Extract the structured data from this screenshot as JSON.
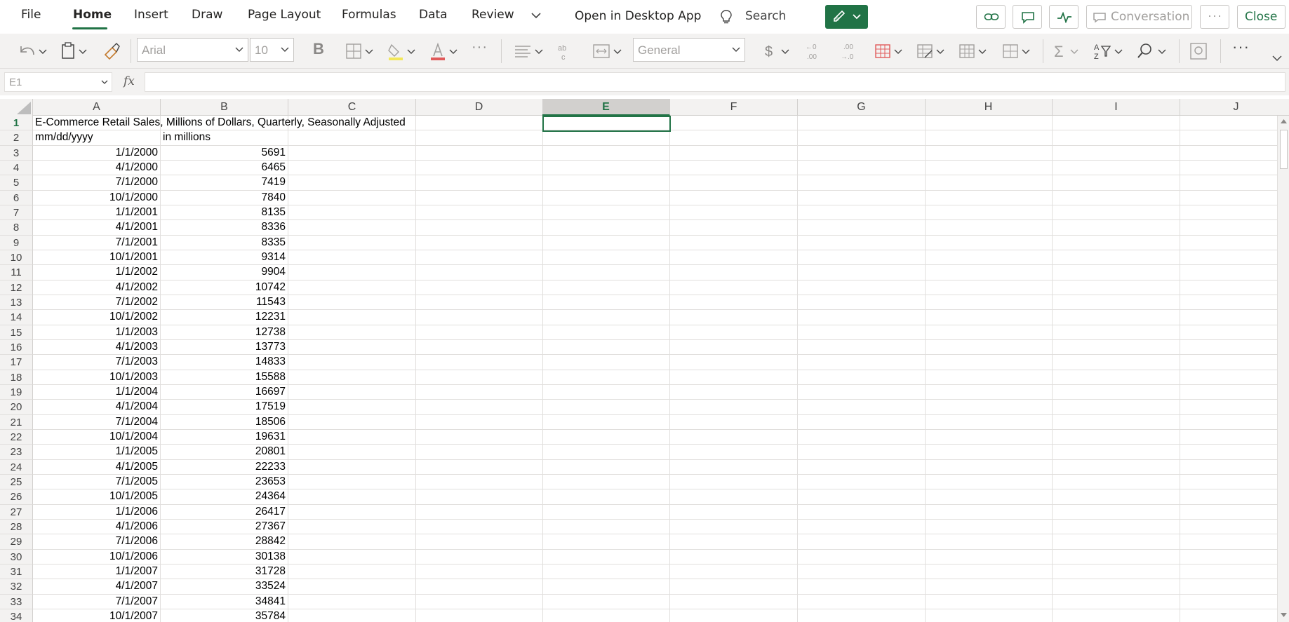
{
  "menu": {
    "items": [
      "File",
      "Home",
      "Insert",
      "Draw",
      "Page Layout",
      "Formulas",
      "Data",
      "Review"
    ],
    "open_desktop": "Open in Desktop App",
    "search": "Search",
    "conversation": "Conversation",
    "close": "Close"
  },
  "ribbon": {
    "font_name": "Arial",
    "font_size": "10",
    "number_format": "General"
  },
  "formula_bar": {
    "name_box": "E1",
    "fx": "fx",
    "formula": ""
  },
  "columns": [
    "A",
    "B",
    "C",
    "D",
    "E",
    "F",
    "G",
    "H",
    "I",
    "J"
  ],
  "selected_column": "E",
  "sheet": {
    "title": "E-Commerce Retail Sales, Millions of Dollars, Quarterly, Seasonally Adjusted",
    "header_a": "mm/dd/yyyy",
    "header_b": "in millions",
    "rows": [
      {
        "n": "3",
        "date": "1/1/2000",
        "value": "5691"
      },
      {
        "n": "4",
        "date": "4/1/2000",
        "value": "6465"
      },
      {
        "n": "5",
        "date": "7/1/2000",
        "value": "7419"
      },
      {
        "n": "6",
        "date": "10/1/2000",
        "value": "7840"
      },
      {
        "n": "7",
        "date": "1/1/2001",
        "value": "8135"
      },
      {
        "n": "8",
        "date": "4/1/2001",
        "value": "8336"
      },
      {
        "n": "9",
        "date": "7/1/2001",
        "value": "8335"
      },
      {
        "n": "10",
        "date": "10/1/2001",
        "value": "9314"
      },
      {
        "n": "11",
        "date": "1/1/2002",
        "value": "9904"
      },
      {
        "n": "12",
        "date": "4/1/2002",
        "value": "10742"
      },
      {
        "n": "13",
        "date": "7/1/2002",
        "value": "11543"
      },
      {
        "n": "14",
        "date": "10/1/2002",
        "value": "12231"
      },
      {
        "n": "15",
        "date": "1/1/2003",
        "value": "12738"
      },
      {
        "n": "16",
        "date": "4/1/2003",
        "value": "13773"
      },
      {
        "n": "17",
        "date": "7/1/2003",
        "value": "14833"
      },
      {
        "n": "18",
        "date": "10/1/2003",
        "value": "15588"
      },
      {
        "n": "19",
        "date": "1/1/2004",
        "value": "16697"
      },
      {
        "n": "20",
        "date": "4/1/2004",
        "value": "17519"
      },
      {
        "n": "21",
        "date": "7/1/2004",
        "value": "18506"
      },
      {
        "n": "22",
        "date": "10/1/2004",
        "value": "19631"
      },
      {
        "n": "23",
        "date": "1/1/2005",
        "value": "20801"
      },
      {
        "n": "24",
        "date": "4/1/2005",
        "value": "22233"
      },
      {
        "n": "25",
        "date": "7/1/2005",
        "value": "23653"
      },
      {
        "n": "26",
        "date": "10/1/2005",
        "value": "24364"
      },
      {
        "n": "27",
        "date": "1/1/2006",
        "value": "26417"
      },
      {
        "n": "28",
        "date": "4/1/2006",
        "value": "27367"
      },
      {
        "n": "29",
        "date": "7/1/2006",
        "value": "28842"
      },
      {
        "n": "30",
        "date": "10/1/2006",
        "value": "30138"
      },
      {
        "n": "31",
        "date": "1/1/2007",
        "value": "31728"
      },
      {
        "n": "32",
        "date": "4/1/2007",
        "value": "33524"
      },
      {
        "n": "33",
        "date": "7/1/2007",
        "value": "34841"
      },
      {
        "n": "34",
        "date": "10/1/2007",
        "value": "35784"
      }
    ]
  },
  "colors": {
    "accent": "#217346"
  }
}
